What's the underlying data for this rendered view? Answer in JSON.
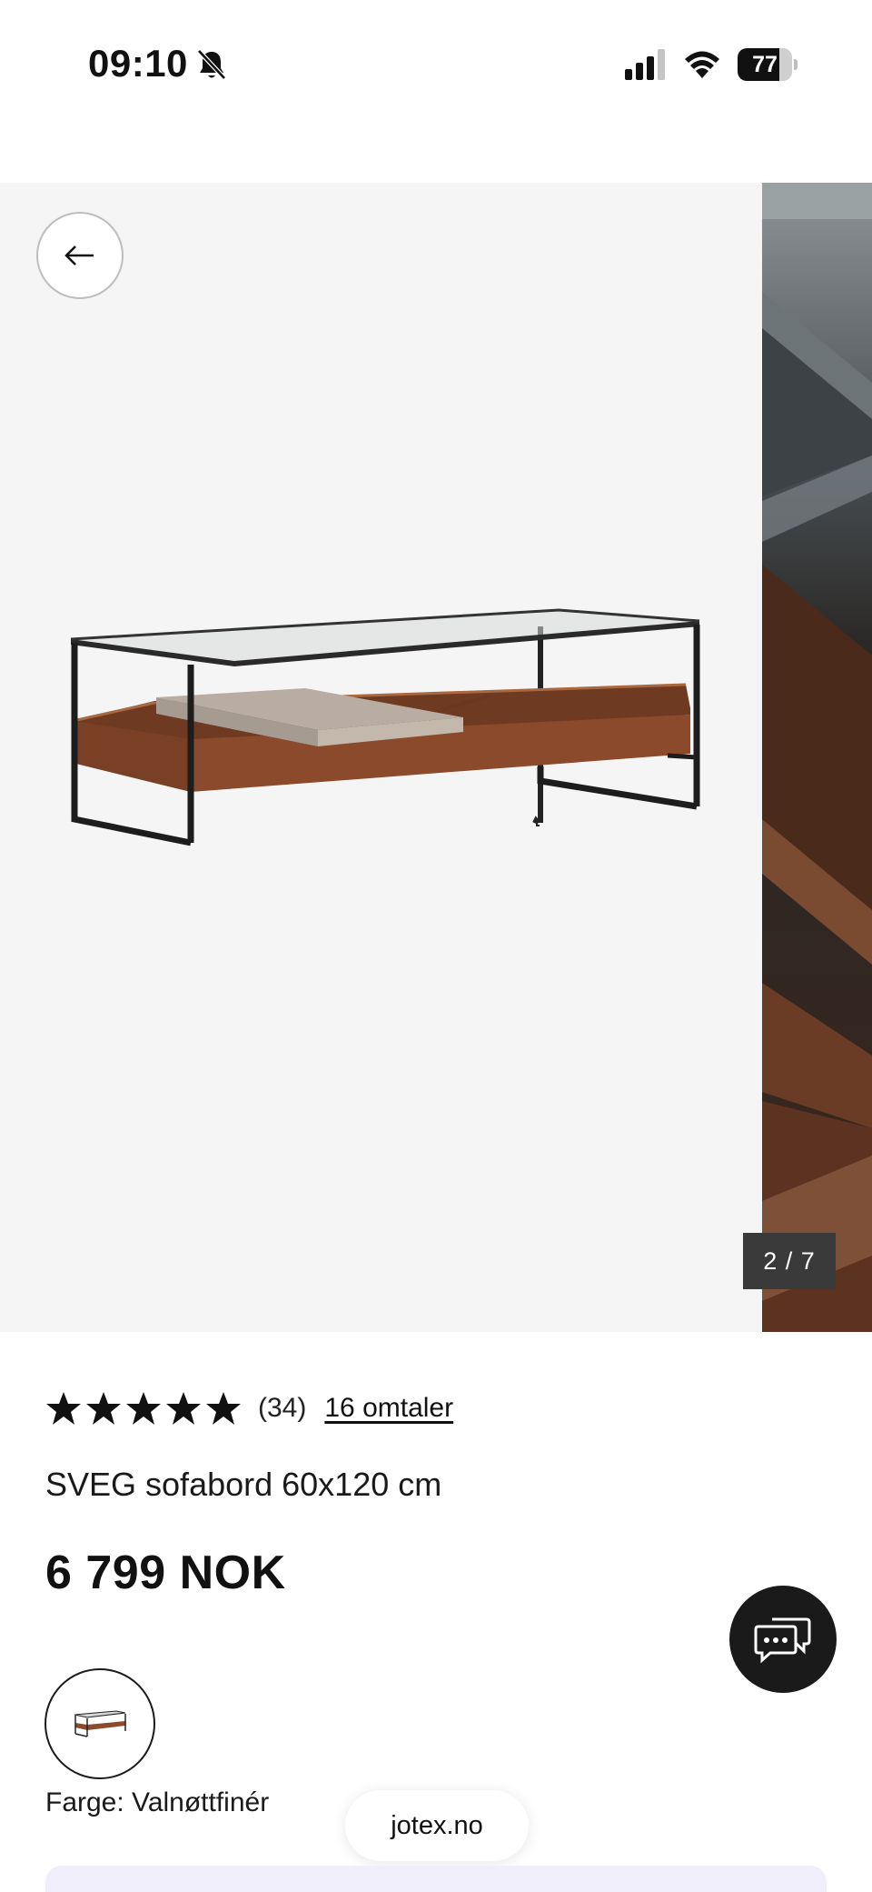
{
  "status_bar": {
    "time": "09:10",
    "battery_percent": "77",
    "battery_level": 0.77,
    "icons": [
      "bell-slash-icon",
      "signal-icon",
      "wifi-icon",
      "battery-icon"
    ]
  },
  "gallery": {
    "counter": "2 / 7",
    "back_icon": "arrow-left-icon"
  },
  "product": {
    "stars": 5,
    "rating_count": "(34)",
    "reviews_link": "16 omtaler",
    "title": "SVEG sofabord 60x120 cm",
    "price": "6 799 NOK",
    "color_label": "Farge: Valnøttfinér"
  },
  "site": {
    "domain": "jotex.no"
  },
  "chat": {
    "icon": "chat-bubbles-icon"
  },
  "colors": {
    "brand_dark": "#1a1a1a",
    "gallery_bg": "#f5f5f5",
    "walnut": "#8a4a2b",
    "bottom_panel": "#efeefa"
  }
}
